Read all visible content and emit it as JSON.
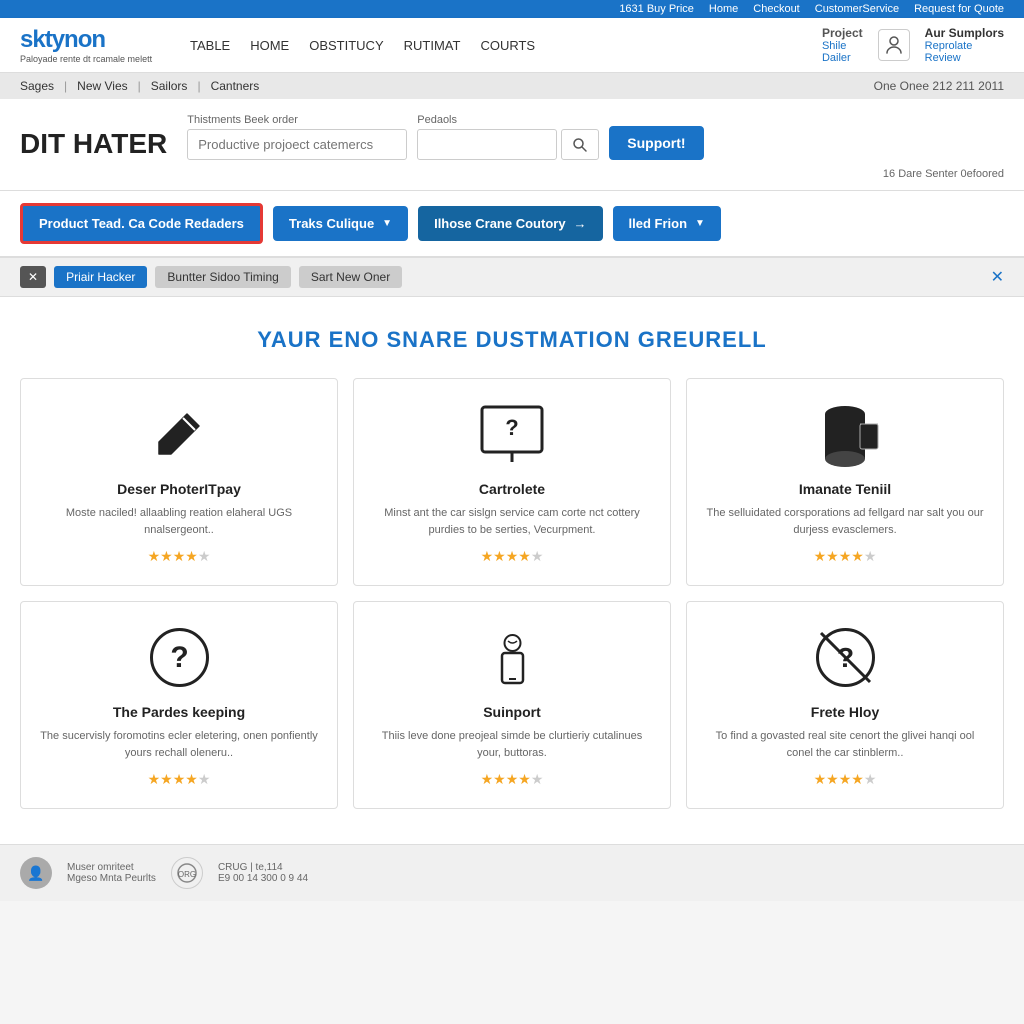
{
  "topbar": {
    "items": [
      "1631 Buy Price",
      "Home",
      "Checkout",
      "CustomerService",
      "Request for Quote"
    ]
  },
  "header": {
    "logo": "sktynon",
    "logo_sub": "Paloyade rente dt rcamale melett",
    "nav": [
      "TABLE",
      "HOME",
      "OBSTITUCY",
      "RUTIMAT",
      "COURTS"
    ],
    "project_label": "Project",
    "project_links": [
      "Shile",
      "Dailer"
    ],
    "user_icon": "👤",
    "aur_label": "Aur Sumplors",
    "aur_links": [
      "Reprolate",
      "Review"
    ]
  },
  "breadcrumb": {
    "items": [
      "Sages",
      "New Vies",
      "Sailors",
      "Cantners"
    ],
    "right_text": "One Onee 212 211 2011"
  },
  "search": {
    "page_title": "DIT HATER",
    "label1": "Thistments Beek order",
    "placeholder1": "Productive projoect catemercs",
    "label2": "Pedaols",
    "placeholder2": "",
    "result_count": "16 Dare Senter 0efoored",
    "support_btn": "Support!"
  },
  "filters": {
    "btn1": "Product Tead. Ca Code Redaders",
    "btn2": "Traks Culique",
    "btn3": "Ilhose Crane Coutory",
    "btn4": "lled Frion"
  },
  "tags": {
    "x_btn": "✕",
    "tag1": "Priair Hacker",
    "tag2": "Buntter Sidoo Timing",
    "tag3": "Sart New Oner",
    "close": "✕"
  },
  "main": {
    "section_title": "YAUR ENO SNARE DUSTMATION GREURELL",
    "cards": [
      {
        "icon": "pencil",
        "title": "Deser PhoterITpay",
        "desc": "Moste naciled! allaabling reation elaheral UGS nnalsergeont..",
        "stars": 4,
        "max_stars": 5
      },
      {
        "icon": "monitor-question",
        "title": "Cartrolete",
        "desc": "Minst ant the car sislgn service cam corte nct cottery purdies to be serties, Vecurpment.",
        "stars": 4,
        "max_stars": 5
      },
      {
        "icon": "cylinder",
        "title": "Imanate Teniil",
        "desc": "The selluidated corsporations ad fellgard nar salt you our durjess evasclemers.",
        "stars": 4,
        "max_stars": 5
      },
      {
        "icon": "help-circle",
        "title": "The Pardes keeping",
        "desc": "The sucervisly foromotins ecler eletering, onen ponfiently yours rechall oleneru..",
        "stars": 4,
        "max_stars": 5
      },
      {
        "icon": "phone",
        "title": "Suinport",
        "desc": "Thiis leve done preojeal simde be clurtieriy cutalinues your, buttoras.",
        "stars": 4,
        "max_stars": 5
      },
      {
        "icon": "no-question",
        "title": "Frete Hloy",
        "desc": "To find a govasted real site cenort the glivei hanqi ool conel the car stinblerm..",
        "stars": 4,
        "max_stars": 5
      }
    ]
  },
  "footer": {
    "user_name": "Muser omriteet",
    "user_sub": "Mgeso Mnta Peurlts",
    "org_text": "CRUG | te,114",
    "org_sub": "E9 00 14 300 0 9 44"
  }
}
